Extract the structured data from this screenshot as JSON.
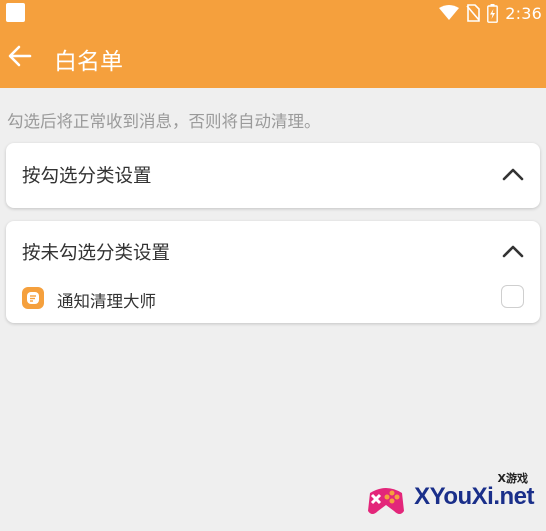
{
  "status_bar": {
    "time": "2:36",
    "icons": [
      "app-notification-icon",
      "wifi-icon",
      "no-sim-icon",
      "battery-icon"
    ]
  },
  "toolbar": {
    "title": "白名单",
    "back_icon": "arrow-left-icon"
  },
  "hint": "勾选后将正常收到消息，否则将自动清理。",
  "sections": [
    {
      "title": "按勾选分类设置",
      "expanded_icon": "chevron-up-icon",
      "items": []
    },
    {
      "title": "按未勾选分类设置",
      "expanded_icon": "chevron-up-icon",
      "items": [
        {
          "name": "通知清理大师",
          "checked": false,
          "icon": "app-icon"
        }
      ]
    }
  ],
  "watermark": {
    "tag": "X游戏",
    "text": "XYouXi.net"
  },
  "colors": {
    "accent": "#f5a03d",
    "background": "#efefef",
    "card": "#ffffff",
    "text_primary": "#333333",
    "text_hint": "#9a9a9a"
  }
}
